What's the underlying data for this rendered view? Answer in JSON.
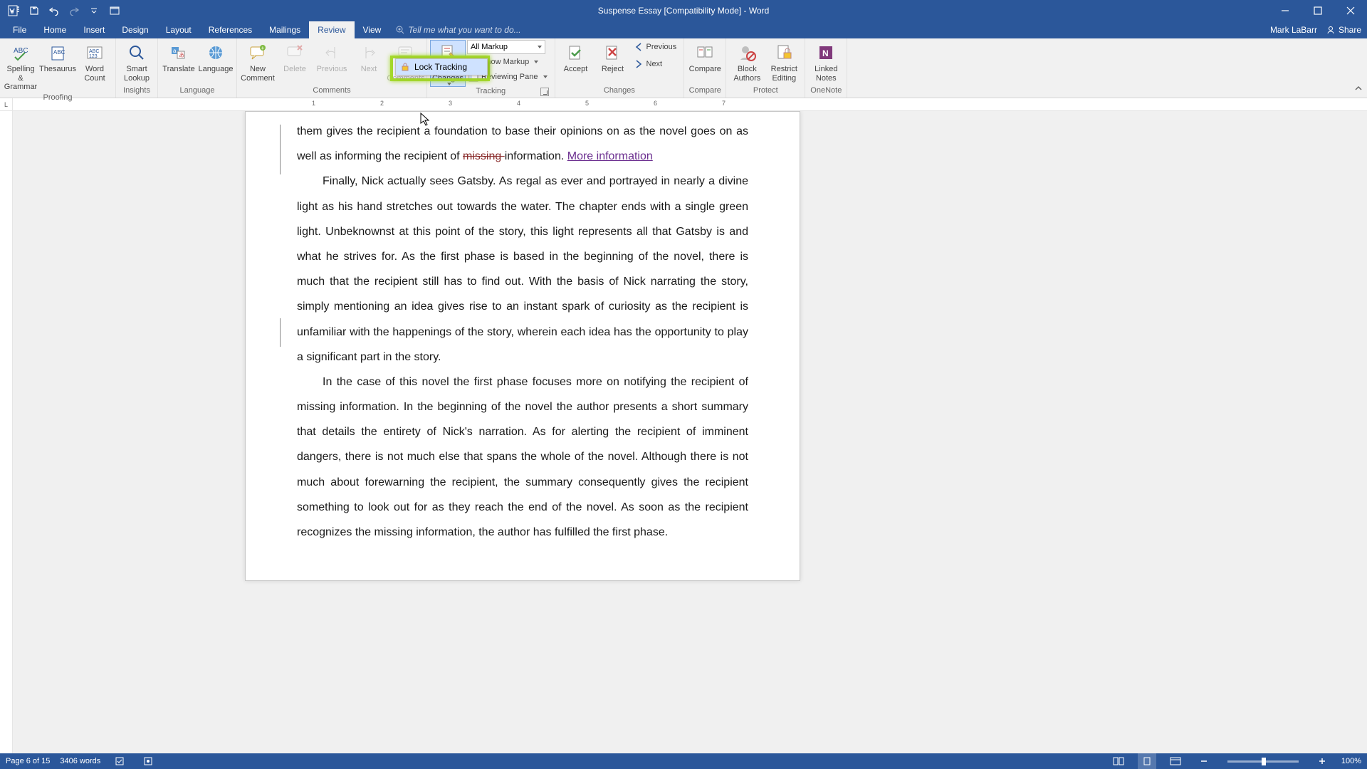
{
  "titlebar": {
    "title": "Suspense Essay [Compatibility Mode] - Word"
  },
  "tabs": {
    "file": "File",
    "home": "Home",
    "insert": "Insert",
    "design": "Design",
    "layout": "Layout",
    "references": "References",
    "mailings": "Mailings",
    "review": "Review",
    "view": "View",
    "tell_me_placeholder": "Tell me what you want to do...",
    "user": "Mark LaBarr",
    "share": "Share"
  },
  "ribbon": {
    "proofing": {
      "label": "Proofing",
      "spelling": "Spelling &\nGrammar",
      "thesaurus": "Thesaurus",
      "word_count": "Word\nCount"
    },
    "insights": {
      "label": "Insights",
      "smart_lookup": "Smart\nLookup"
    },
    "language": {
      "label": "Language",
      "translate": "Translate",
      "lang": "Language"
    },
    "comments": {
      "label": "Comments",
      "new": "New\nComment",
      "delete": "Delete",
      "previous": "Previous",
      "next": "Next",
      "show": "Show\nComments"
    },
    "tracking": {
      "label": "Tracking",
      "track": "Track\nChanges",
      "markup_mode": "All Markup",
      "show_markup": "Show Markup",
      "reviewing_pane": "Reviewing Pane",
      "menu": {
        "lock": "Lock Tracking"
      }
    },
    "changes": {
      "label": "Changes",
      "accept": "Accept",
      "reject": "Reject",
      "previous": "Previous",
      "next": "Next"
    },
    "compare": {
      "label": "Compare",
      "compare": "Compare"
    },
    "protect": {
      "label": "Protect",
      "block": "Block\nAuthors",
      "restrict": "Restrict\nEditing"
    },
    "onenote": {
      "label": "OneNote",
      "linked": "Linked\nNotes"
    }
  },
  "ruler": {
    "corner": "L",
    "nums": [
      "1",
      "2",
      "3",
      "4",
      "5",
      "6",
      "7"
    ]
  },
  "document": {
    "p1_a": "them gives the recipient a foundation to base their opinions on as the novel goes on as well as informing the recipient of ",
    "p1_strike": "missing ",
    "p1_b": "information. ",
    "p1_link": "More information",
    "p2": "Finally, Nick actually sees Gatsby. As regal as ever and portrayed in nearly a divine light as his hand stretches out towards the water. The chapter ends with a single green light. Unbeknownst at this point of the story, this light represents all that Gatsby is and what he strives for. As the first phase is based in the beginning of the novel, there is much that the recipient still has to find out. With the basis of Nick narrating the story, simply mentioning an idea gives rise to an instant spark of curiosity as the recipient is unfamiliar with the happenings of the story, wherein each idea has the opportunity to play a significant part in the story.",
    "p3": "In the case of this novel the first phase focuses more on notifying the recipient of missing information. In the beginning of the novel the author presents a short summary that details the entirety of Nick's narration. As for alerting the recipient of imminent dangers, there is not much else that spans the whole of the novel. Although there is not much about forewarning the recipient, the summary consequently gives the recipient something to look out for as they reach the end of the novel. As soon as the recipient recognizes the missing information, the author has fulfilled the first phase."
  },
  "status": {
    "page": "Page 6 of 15",
    "words": "3406 words",
    "zoom": "100%"
  }
}
